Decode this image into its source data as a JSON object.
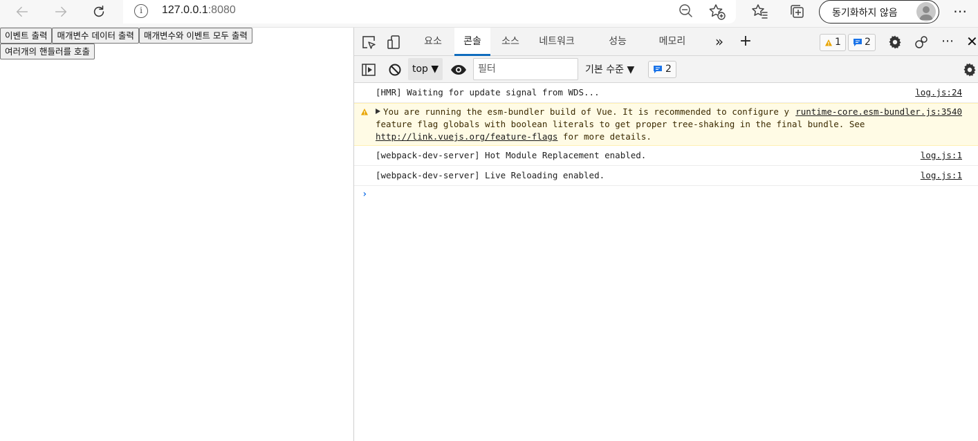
{
  "browser": {
    "url_host": "127.0.0.1",
    "url_port": ":8080",
    "sync_label": "동기화하지 않음"
  },
  "page": {
    "buttons_row1": [
      "이벤트 출력",
      "매개변수 데이터 출력",
      "매개변수와 이벤트 모두 출력"
    ],
    "buttons_row2": [
      "여러개의 핸들러를 호출"
    ]
  },
  "devtools": {
    "tabs": [
      {
        "label": "요소",
        "active": false
      },
      {
        "label": "콘솔",
        "active": true
      },
      {
        "label": "소스",
        "active": false
      },
      {
        "label": "네트워크",
        "active": false
      },
      {
        "label": "성능",
        "active": false
      },
      {
        "label": "메모리",
        "active": false
      }
    ],
    "more_tabs_glyph": "»",
    "add_tab_glyph": "+",
    "warning_count": "1",
    "message_count": "2",
    "close_glyph": "✕",
    "toolbar": {
      "context": "top",
      "filter_placeholder": "필터",
      "level_label": "기본 수준",
      "issue_count": "2"
    },
    "console": {
      "messages": [
        {
          "text": "[HMR] Waiting for update signal from WDS...",
          "source": "log.js:24"
        },
        {
          "text_before_link": "You are running the esm-bundler build of Vue. It is recommended to configure your bundler to explicitly replace feature flag globals with boolean literals to get proper tree-shaking in the final bundle. See ",
          "link": "http://link.vuejs.org/feature-flags",
          "text_after_link": " for more details.",
          "source": "runtime-core.esm-bundler.js:3540"
        },
        {
          "text": "[webpack-dev-server] Hot Module Replacement enabled.",
          "source": "log.js:1"
        },
        {
          "text": "[webpack-dev-server] Live Reloading enabled.",
          "source": "log.js:1"
        }
      ],
      "prompt_glyph": "›"
    }
  },
  "colors": {
    "accent": "#0f6cbd",
    "warning_bg": "#fffbe5",
    "warning_icon": "#e8a400",
    "message_icon": "#1a73e8"
  }
}
